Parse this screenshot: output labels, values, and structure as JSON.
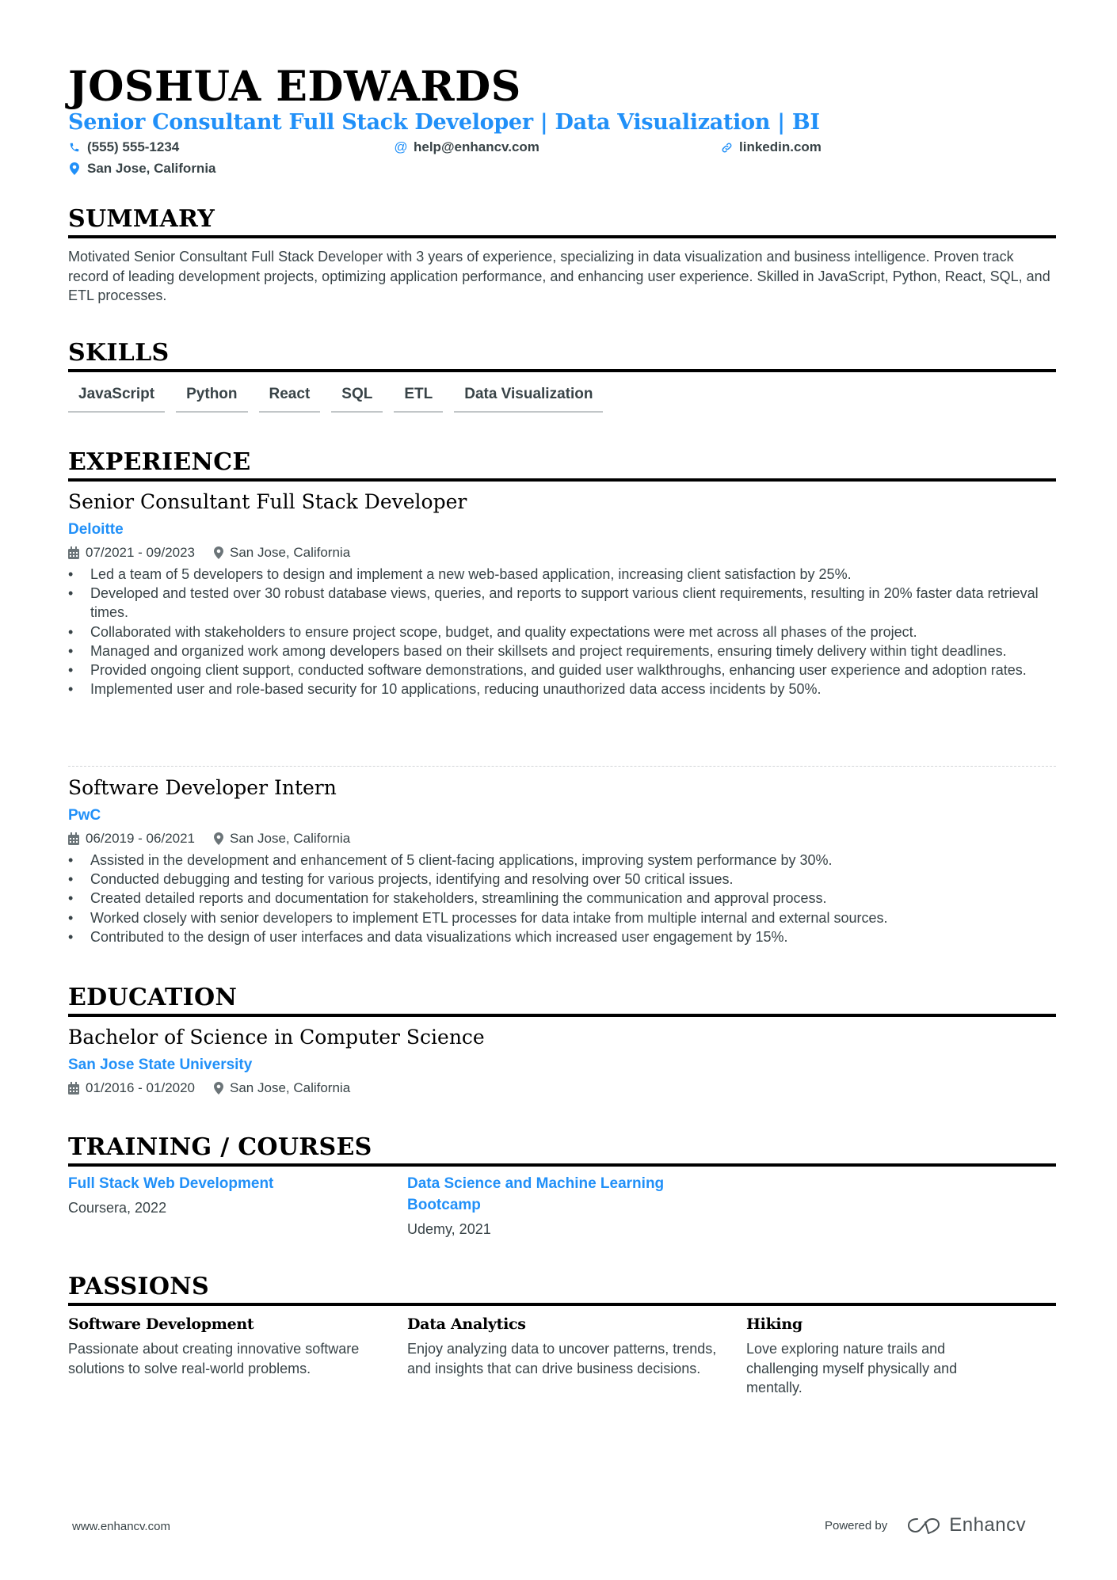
{
  "header": {
    "name": "JOSHUA EDWARDS",
    "title": "Senior Consultant Full Stack Developer | Data Visualization | BI",
    "contacts": {
      "phone": {
        "icon": "phone-icon",
        "value": "(555) 555-1234"
      },
      "email": {
        "icon": "at-icon",
        "value": "help@enhancv.com"
      },
      "link": {
        "icon": "link-icon",
        "value": "linkedin.com"
      },
      "location": {
        "icon": "map-pin-icon",
        "value": "San Jose, California"
      }
    }
  },
  "sections": {
    "summary": {
      "heading": "SUMMARY",
      "text": "Motivated Senior Consultant Full Stack Developer with 3 years of experience, specializing in data visualization and business intelligence. Proven track record of leading development projects, optimizing application performance, and enhancing user experience. Skilled in JavaScript, Python, React, SQL, and ETL processes."
    },
    "skills": {
      "heading": "SKILLS",
      "items": [
        "JavaScript",
        "Python",
        "React",
        "SQL",
        "ETL",
        "Data Visualization"
      ]
    },
    "experience": {
      "heading": "EXPERIENCE",
      "entries": [
        {
          "role": "Senior Consultant Full Stack Developer",
          "company": "Deloitte",
          "dates": "07/2021 - 09/2023",
          "location": "San Jose, California",
          "bullets": [
            "Led a team of 5 developers to design and implement a new web-based application, increasing client satisfaction by 25%.",
            "Developed and tested over 30 robust database views, queries, and reports to support various client requirements, resulting in 20% faster data retrieval times.",
            "Collaborated with stakeholders to ensure project scope, budget, and quality expectations were met across all phases of the project.",
            "Managed and organized work among developers based on their skillsets and project requirements, ensuring timely delivery within tight deadlines.",
            "Provided ongoing client support, conducted software demonstrations, and guided user walkthroughs, enhancing user experience and adoption rates.",
            "Implemented user and role-based security for 10 applications, reducing unauthorized data access incidents by 50%."
          ]
        },
        {
          "role": "Software Developer Intern",
          "company": "PwC",
          "dates": "06/2019 - 06/2021",
          "location": "San Jose, California",
          "bullets": [
            "Assisted in the development and enhancement of 5 client-facing applications, improving system performance by 30%.",
            "Conducted debugging and testing for various projects, identifying and resolving over 50 critical issues.",
            "Created detailed reports and documentation for stakeholders, streamlining the communication and approval process.",
            "Worked closely with senior developers to implement ETL processes for data intake from multiple internal and external sources.",
            "Contributed to the design of user interfaces and data visualizations which increased user engagement by 15%."
          ]
        }
      ]
    },
    "education": {
      "heading": "EDUCATION",
      "entries": [
        {
          "degree": "Bachelor of Science in Computer Science",
          "school": "San Jose State University",
          "dates": "01/2016 - 01/2020",
          "location": "San Jose, California"
        }
      ]
    },
    "training": {
      "heading": "TRAINING / COURSES",
      "items": [
        {
          "title": "Full Stack Web Development",
          "source": "Coursera, 2022"
        },
        {
          "title": "Data Science and Machine Learning Bootcamp",
          "source": "Udemy, 2021"
        }
      ]
    },
    "passions": {
      "heading": "PASSIONS",
      "items": [
        {
          "title": "Software Development",
          "text": "Passionate about creating innovative software solutions to solve real-world problems."
        },
        {
          "title": "Data Analytics",
          "text": "Enjoy analyzing data to uncover patterns, trends, and insights that can drive business decisions."
        },
        {
          "title": "Hiking",
          "text": "Love exploring nature trails and challenging myself physically and mentally."
        }
      ]
    }
  },
  "footer": {
    "website": "www.enhancv.com",
    "powered_by": "Powered by",
    "brand": "Enhancv"
  },
  "colors": {
    "accent": "#2190f8",
    "text": "#384347",
    "heading": "#000000"
  }
}
